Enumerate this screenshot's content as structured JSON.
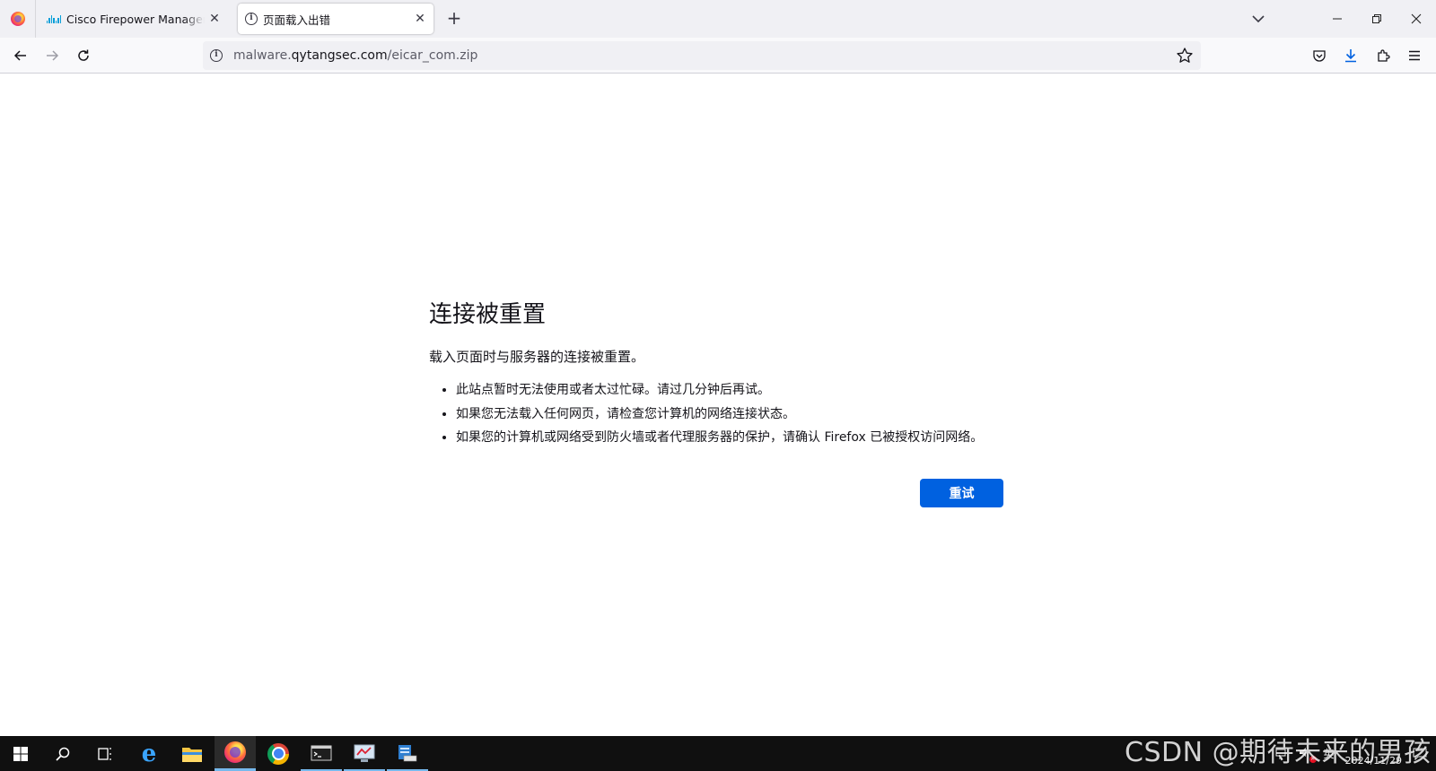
{
  "tabs": [
    {
      "title": "Cisco Firepower Management Center",
      "icon": "cisco-icon"
    },
    {
      "title": "页面载入出错",
      "icon": "info-icon"
    }
  ],
  "navbar": {
    "url_domain_prefix": "malware.",
    "url_domain": "qytangsec.com",
    "url_path": "/eicar_com.zip"
  },
  "error": {
    "title": "连接被重置",
    "description": "载入页面时与服务器的连接被重置。",
    "items": [
      "此站点暂时无法使用或者太过忙碌。请过几分钟后再试。",
      "如果您无法载入任何网页，请检查您计算机的网络连接状态。",
      "如果您的计算机或网络受到防火墙或者代理服务器的保护，请确认 Firefox 已被授权访问网络。"
    ],
    "retry_label": "重试"
  },
  "taskbar": {
    "items": [
      "windows-start-icon",
      "search-icon",
      "task-view-icon",
      "internet-explorer-icon",
      "file-explorer-icon",
      "firefox-icon",
      "chrome-icon",
      "terminal-icon",
      "monitor-app-icon",
      "server-manager-icon"
    ],
    "ime": "英",
    "date": "2024/11/29"
  },
  "watermark": "CSDN @期待未来的男孩",
  "colors": {
    "accent": "#0061e0",
    "tab_strip": "#f0f0f4",
    "taskbar": "#101010"
  }
}
